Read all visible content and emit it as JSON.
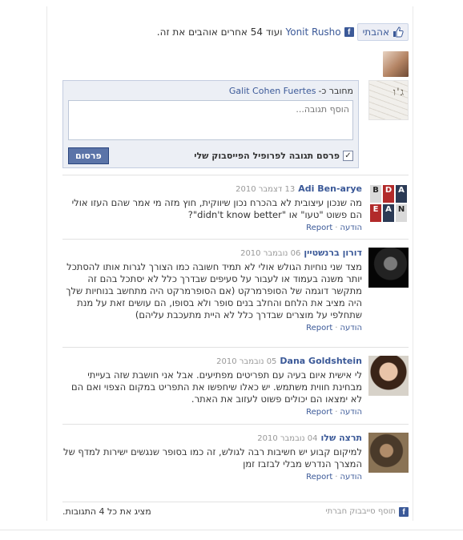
{
  "like": {
    "button_label": "אהבתי",
    "friend_name": "Yonit Rusho",
    "others_text": "ועוד 54 אחרים אוהבים את זה."
  },
  "composer": {
    "posting_as_prefix": "מחובר כ-",
    "posting_as_name": "Galit Cohen Fuertes",
    "placeholder": "הוסף תגובה...",
    "checkbox_label": "פרסם תגובה לפרופיל הפייסבוק שלי",
    "checkbox_checked": true,
    "post_button": "פרסום",
    "avatar_scribble": "ג'ו"
  },
  "comments": [
    {
      "name": "Adi Ben-arye",
      "date": "13 דצמבר 2010",
      "body": "מה שנכון עיצובית לא בהכרח נכון שיווקית, חוץ מזה מי אמר שהם העזו אולי הם פשוט \"טעו\" או \"didn't know better\"?",
      "reply": "הודעה",
      "report": "Report",
      "avatar": "letters",
      "avatar_letters": [
        "A",
        "D",
        "B",
        "N",
        "A",
        "E"
      ]
    },
    {
      "name": "דורון ברנשטיין",
      "date": "06 נובמבר 2010",
      "body": "מצד שני נוחיות הגולש אולי לא תמיד חשובה כמו הצורך לגרות אותו להסתכל יותר משנה בעמוד או לעבור על סעיפים שבדרך כלל לא יסתכל בהם זה מתקשר דוגמה של הסופרמרקט (אם הסופרמרקט היה מתחשב בנוחיות שלך היה מציב את הלחם והחלב בנים סופר ולא בסופו, הם עושים זאת על מנת שתחלפי על מוצרים שבדרך כלל לא היית מתעכבת עליהם)",
      "reply": "הודעה",
      "report": "Report",
      "avatar": "dark"
    },
    {
      "name": "Dana Goldshtein",
      "date": "05 נובמבר 2010",
      "body": "לי אישית איום בעיה עם תפריטים מפתיעים. אבל אני חושבת שזה בעייתי מבחינת חווית משתמש. יש כאלו שיחפשו את התפריט במקום הצפוי ואם הם לא ימצאו הם יכולים פשוט לעזוב את האתר.",
      "reply": "הודעה",
      "report": "Report",
      "avatar": "woman"
    },
    {
      "name": "תרצה שלו",
      "date": "04 נובמבר 2010",
      "body": "למיקום קבוע יש חשיבות רבה לגולש, זה כמו בסופר שנגשים ישירות למדף של המצרך הנדרש מבלי לבזבז זמן",
      "reply": "הודעה",
      "report": "Report",
      "avatar": "woman2"
    }
  ],
  "footer": {
    "plugin_label": "תוסף סייבבוק חברתי",
    "show_all": "מציג את כל 4 התגובות."
  },
  "colors": {
    "facebook_blue": "#3b5998",
    "composer_bg": "#eceff5",
    "button_bg": "#5b74a8"
  }
}
